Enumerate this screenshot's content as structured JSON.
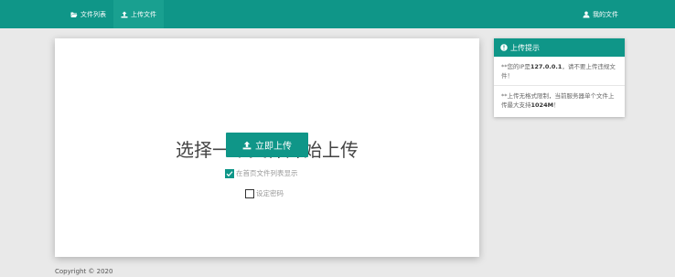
{
  "colors": {
    "accent": "#0f9688",
    "active_nav": "#19a090",
    "background": "#e9e9e9"
  },
  "nav": {
    "items": [
      {
        "icon": "folder-open-icon",
        "label": "文件列表"
      },
      {
        "icon": "upload-icon",
        "label": "上传文件"
      }
    ],
    "right": {
      "icon": "user-icon",
      "label": "我的文件"
    }
  },
  "main": {
    "title": "选择一个文件开始上传",
    "upload_button": "立即上传",
    "options": {
      "show_on_home": {
        "label": "在首页文件列表显示",
        "checked": true
      },
      "set_password": {
        "label": "设定密码",
        "checked": false
      }
    }
  },
  "side": {
    "header": "上传提示",
    "tip1_prefix": "**您的IP是",
    "tip1_ip": "127.0.0.1",
    "tip1_suffix": "，请不要上传违规文件！",
    "tip2_prefix": "**上传无格式限制，当前服务器单个文件上传最大支持",
    "tip2_size": "1024M",
    "tip2_suffix": "！"
  },
  "footer": {
    "copyright": "Copyright © 2020"
  }
}
